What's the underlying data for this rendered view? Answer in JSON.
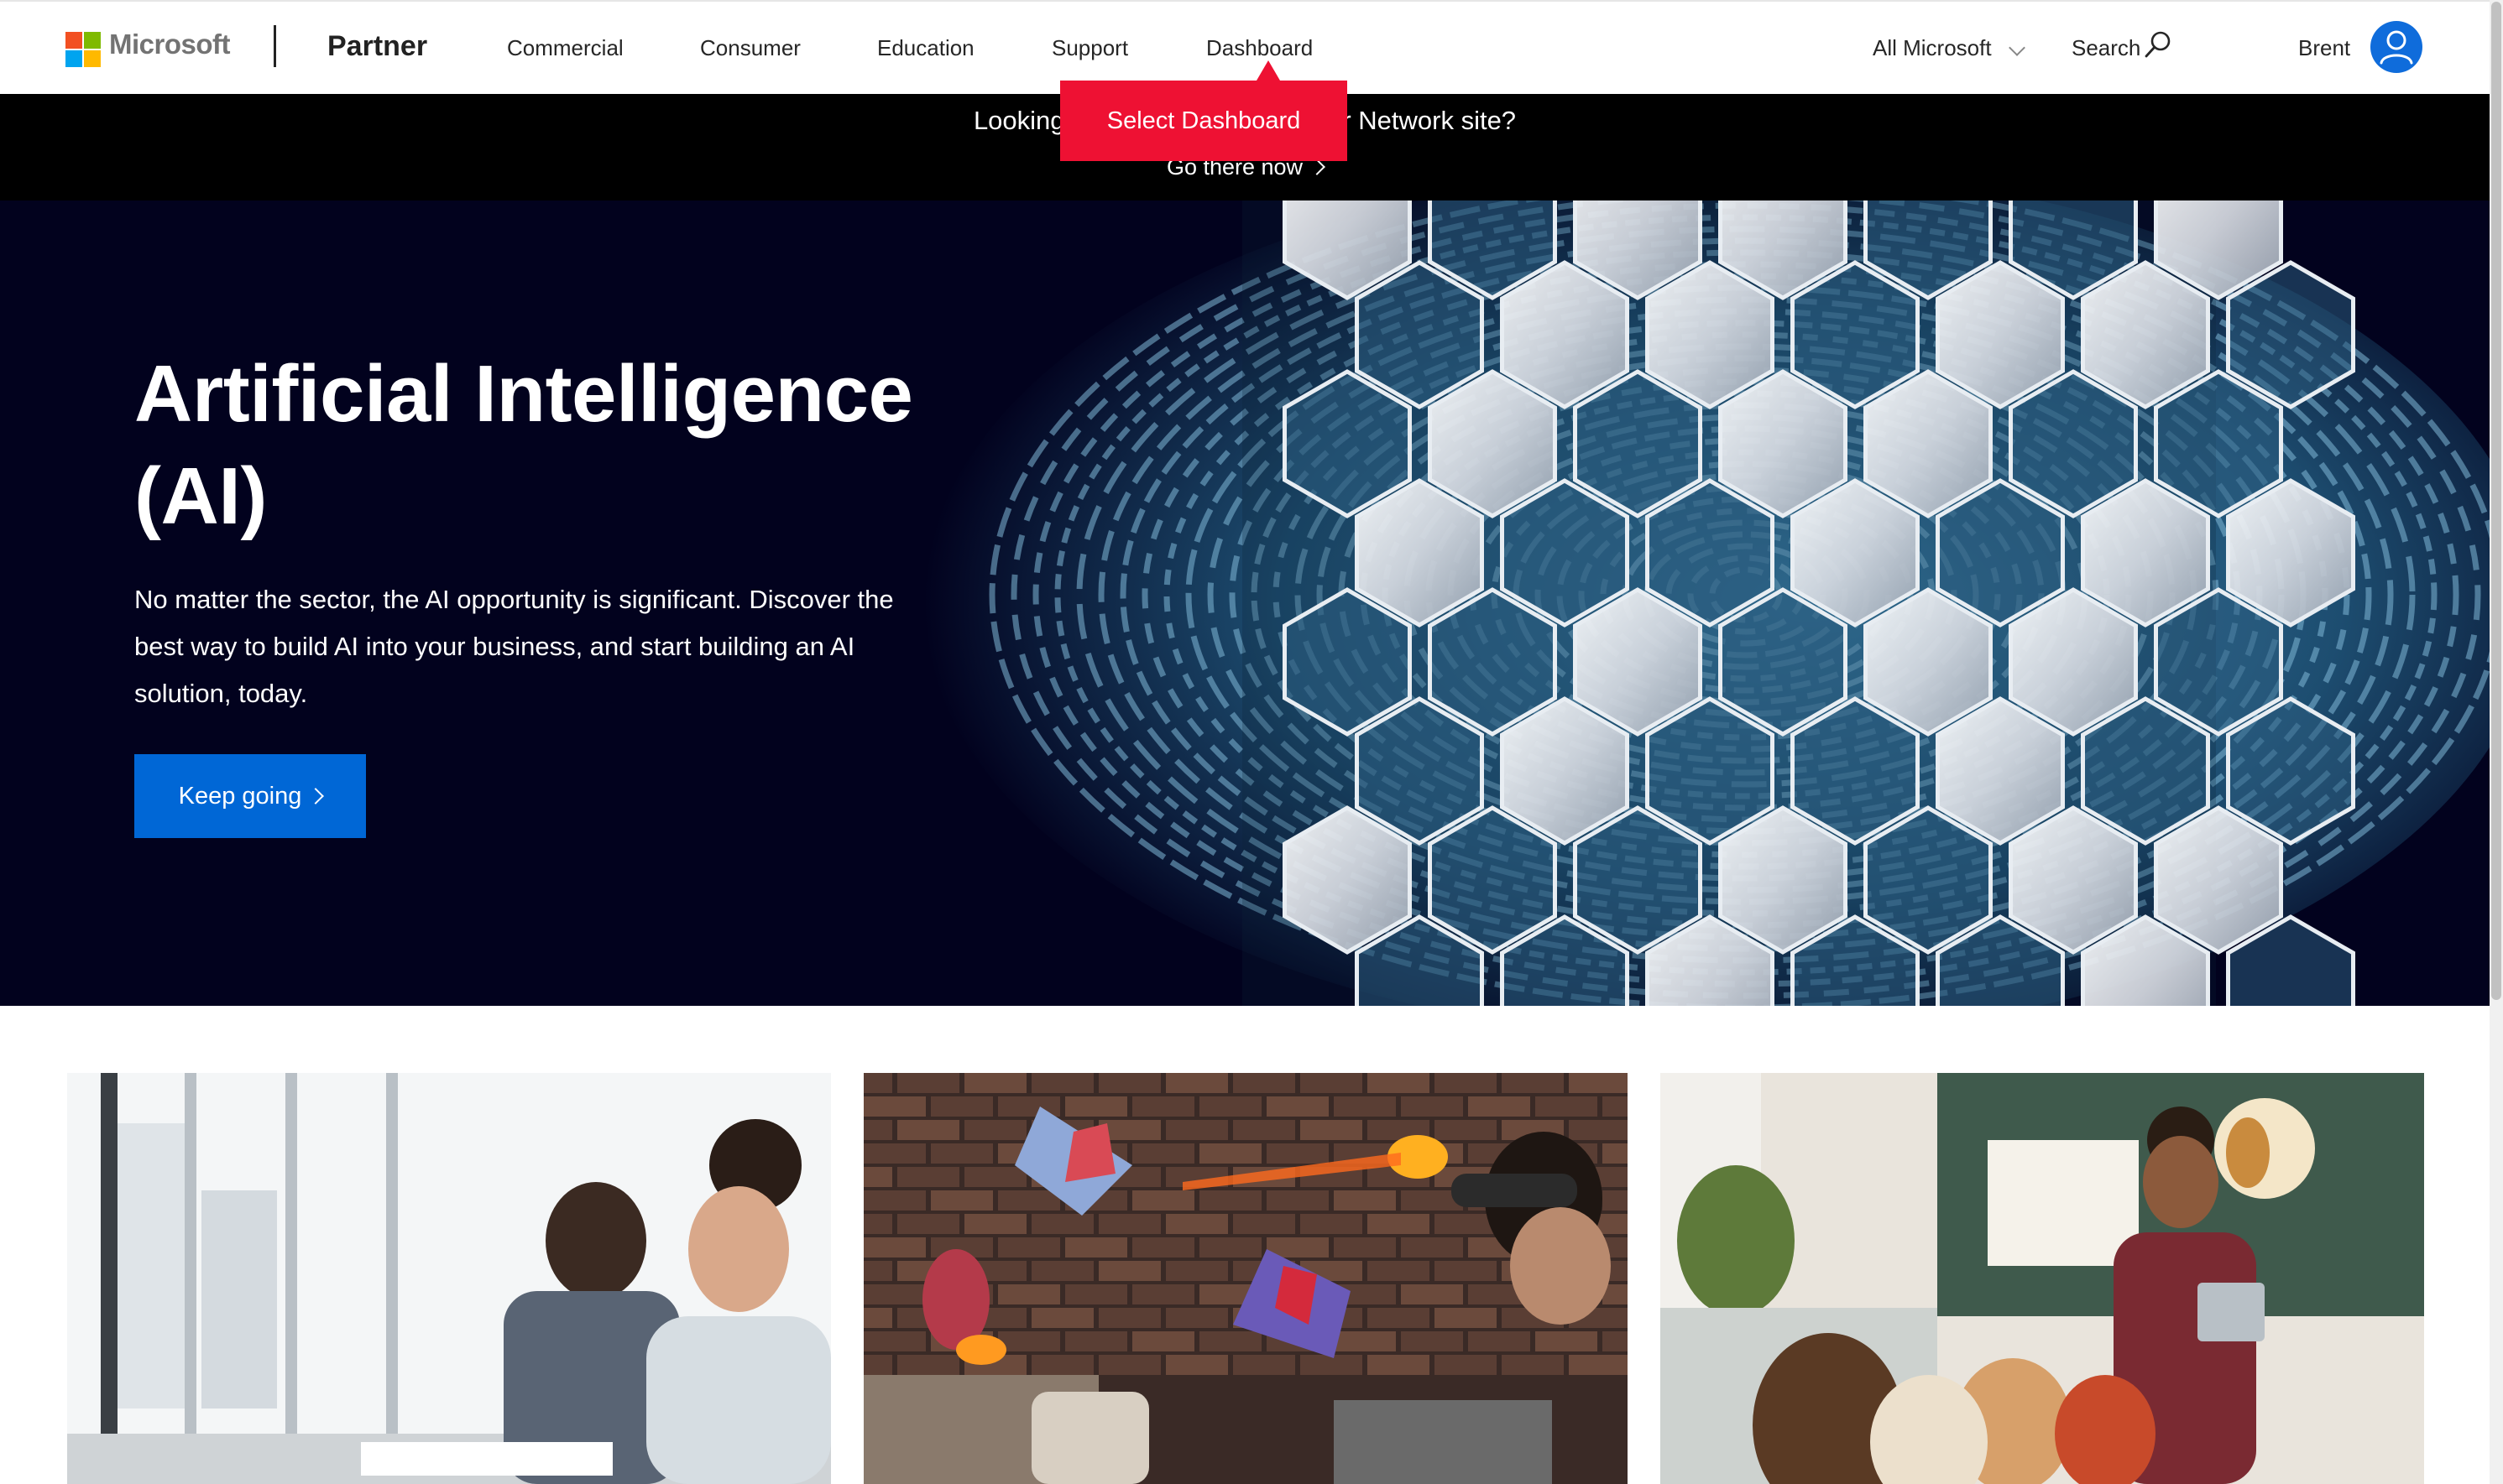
{
  "brand": {
    "wordmark": "Microsoft",
    "site_title": "Partner",
    "logo_colors": [
      "#f25022",
      "#7fba00",
      "#00a4ef",
      "#ffb900"
    ]
  },
  "nav": {
    "links": [
      "Commercial",
      "Consumer",
      "Education",
      "Support",
      "Dashboard"
    ],
    "all_microsoft": "All Microsoft",
    "search_label": "Search",
    "user_name": "Brent"
  },
  "announcement": {
    "text": "Looking for the Microsoft Partner Network site?",
    "link_label": "Go there now"
  },
  "tooltip": {
    "label": "Select Dashboard",
    "color": "#ee1133"
  },
  "hero": {
    "title": "Artificial Intelligence (AI)",
    "description": "No matter the sector, the AI opportunity is significant. Discover the best way to build AI into your business, and start building an AI solution, today.",
    "button_label": "Keep going",
    "button_color": "#0067d6",
    "background_color": "#02021e"
  },
  "icons": {
    "search": "search-icon",
    "user": "user-avatar-icon",
    "chevron": "chevron-right-icon",
    "dropdown": "chevron-down-icon"
  }
}
